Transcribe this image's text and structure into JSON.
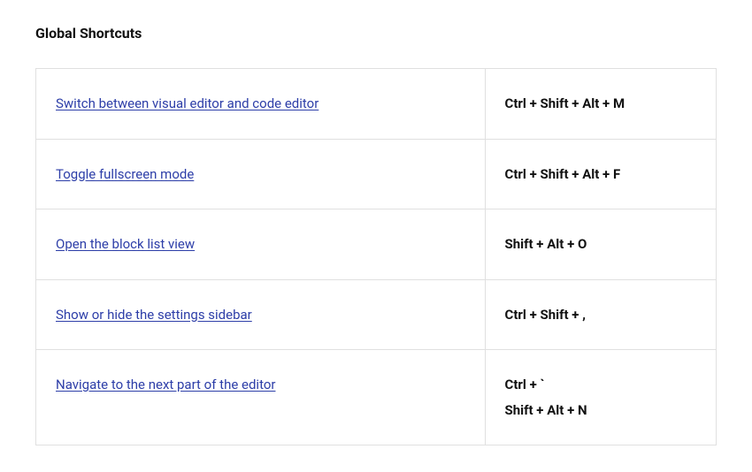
{
  "section_title": "Global Shortcuts",
  "rows": [
    {
      "desc": "Switch between visual editor and code editor",
      "keys": [
        "Ctrl + Shift + Alt + M"
      ]
    },
    {
      "desc": "Toggle fullscreen mode",
      "keys": [
        "Ctrl + Shift + Alt + F"
      ]
    },
    {
      "desc": "Open the block list view",
      "keys": [
        "Shift + Alt + O"
      ]
    },
    {
      "desc": "Show or hide the settings sidebar",
      "keys": [
        "Ctrl + Shift + ,"
      ]
    },
    {
      "desc": "Navigate to the next part of the editor",
      "keys": [
        "Ctrl + `",
        "Shift + Alt + N"
      ]
    }
  ]
}
